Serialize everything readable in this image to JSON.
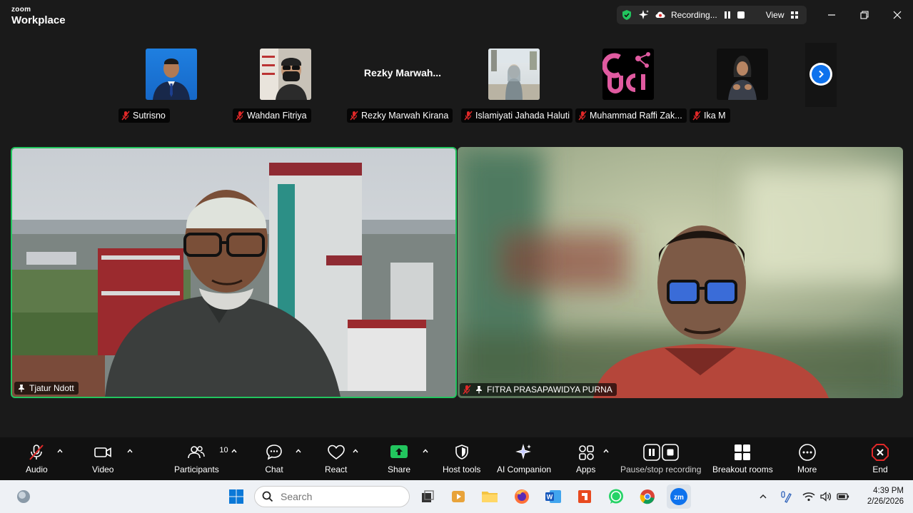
{
  "app": {
    "brand_top": "zoom",
    "brand_bottom": "Workplace"
  },
  "recording_bar": {
    "status": "Recording...",
    "view_label": "View"
  },
  "gallery": {
    "participants": [
      {
        "name": "Sutrisno",
        "muted": true,
        "has_video": true
      },
      {
        "name": "Wahdan Fitriya",
        "muted": true,
        "has_video": true
      },
      {
        "name": "Rezky Marwah Kirana",
        "display_name": "Rezky  Marwah...",
        "muted": true,
        "has_video": false
      },
      {
        "name": "Islamiyati Jahada Haluti",
        "muted": true,
        "has_video": true
      },
      {
        "name": "Muhammad Raffi Zak...",
        "muted": true,
        "has_video": true
      },
      {
        "name": "Ika M",
        "muted": true,
        "has_video": true
      }
    ]
  },
  "videos": {
    "left": {
      "name": "Tjatur Ndott",
      "pinned": true,
      "active_speaker": true
    },
    "right": {
      "name": "FITRA PRASAPAWIDYA PURNA",
      "pinned": true,
      "muted": true
    }
  },
  "toolbar": {
    "audio": "Audio",
    "video": "Video",
    "participants": "Participants",
    "participants_count": "10",
    "chat": "Chat",
    "react": "React",
    "share": "Share",
    "host_tools": "Host tools",
    "ai_companion": "AI Companion",
    "apps": "Apps",
    "pause_stop": "Pause/stop recording",
    "breakout": "Breakout rooms",
    "more": "More",
    "end": "End"
  },
  "taskbar": {
    "search_placeholder": "Search",
    "time": "4:39 PM",
    "date": "2/26/2026"
  },
  "colors": {
    "active_speaker_border": "#22c55e",
    "share_green": "#22c55e",
    "end_red": "#e02828",
    "muted_red": "#e02828",
    "zoom_blue": "#0e72ed"
  }
}
